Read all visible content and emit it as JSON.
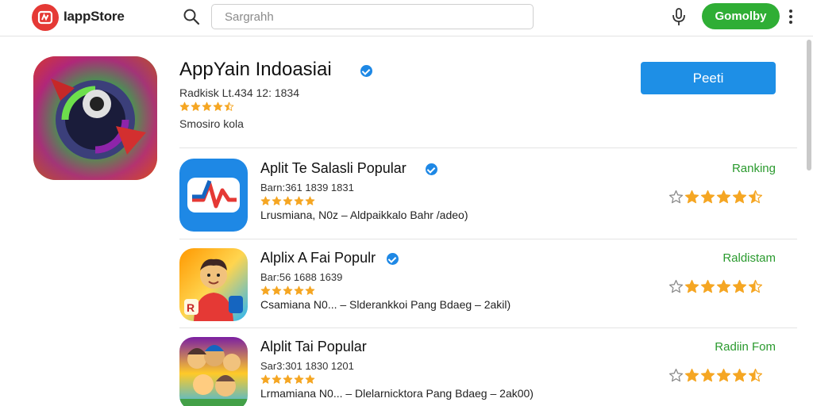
{
  "header": {
    "brand": "IappStore",
    "search_placeholder": "Sargrahh",
    "cta_label": "Gomolby"
  },
  "featured": {
    "title": "AppYain Indoasiai",
    "meta": "Radkisk Lt.434 12: 1834",
    "subtitle": "Smosiro kola",
    "rating": 4.5,
    "button_label": "Peeti"
  },
  "apps": [
    {
      "title": "Aplit Te Salasli Popular",
      "meta": "Barn:361 1839 1831",
      "description": "Lrusmiana, N0z – Aldpaikkalo Bahr /adeo)",
      "label": "Ranking",
      "stars_small": 5,
      "rating": 4.5
    },
    {
      "title": "Alplix A Fai Populr",
      "meta": "Bar:56 1688 1639",
      "description": "Csamiana  N0... – Slderankkoi Pang Bdaeg – 2akil)",
      "label": "Raldistam",
      "stars_small": 5,
      "rating": 4.5
    },
    {
      "title": "Alplit Tai Popular",
      "meta": "Sar3:301 1830 1201",
      "description": "Lrmamiana  N0... – Dlelarnicktora Pang Bdaeg – 2ak00)",
      "label": "Radiin Fom",
      "stars_small": 5,
      "rating": 4.5
    }
  ],
  "colors": {
    "accent_green": "#2fae35",
    "accent_blue": "#1e8fe6",
    "brand_red": "#e53935",
    "star": "#f5a623"
  },
  "icons": {
    "logo": "appstore-logo-icon",
    "search": "search-icon",
    "mic": "microphone-icon",
    "more": "more-vertical-icon",
    "verified": "verified-badge-icon"
  }
}
